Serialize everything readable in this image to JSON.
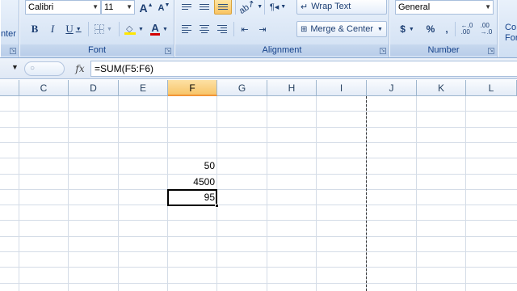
{
  "ribbon": {
    "clipboard_partial_label": "nter",
    "font": {
      "name": "Calibri",
      "size": "11",
      "label": "Font",
      "bold": "B",
      "italic": "I",
      "underline": "U",
      "grow": "A",
      "shrink": "A",
      "font_color": "A"
    },
    "alignment": {
      "label": "Alignment",
      "wrap_text": "Wrap Text",
      "merge_center": "Merge & Center"
    },
    "number": {
      "label": "Number",
      "format": "General",
      "currency": "$",
      "percent": "%",
      "comma": ",",
      "inc_decimal": ".0→.00",
      "dec_decimal": ".00→.0"
    },
    "styles_partial": [
      "Co",
      "For"
    ]
  },
  "formula_bar": {
    "fx": "fx",
    "formula": "=SUM(F5:F6)"
  },
  "columns": [
    {
      "name": "C",
      "selected": false
    },
    {
      "name": "D",
      "selected": false
    },
    {
      "name": "E",
      "selected": false
    },
    {
      "name": "F",
      "selected": true
    },
    {
      "name": "G",
      "selected": false
    },
    {
      "name": "H",
      "selected": false
    },
    {
      "name": "I",
      "selected": false
    },
    {
      "name": "J",
      "selected": false
    },
    {
      "name": "K",
      "selected": false
    },
    {
      "name": "L",
      "selected": false
    }
  ],
  "cells": {
    "f5": "50",
    "f6": "4500",
    "f7": "95"
  },
  "colors": {
    "ribbon_bg": "#dbe7f6",
    "selected_header": "#f7c56a",
    "gridline": "#d4dce7"
  }
}
